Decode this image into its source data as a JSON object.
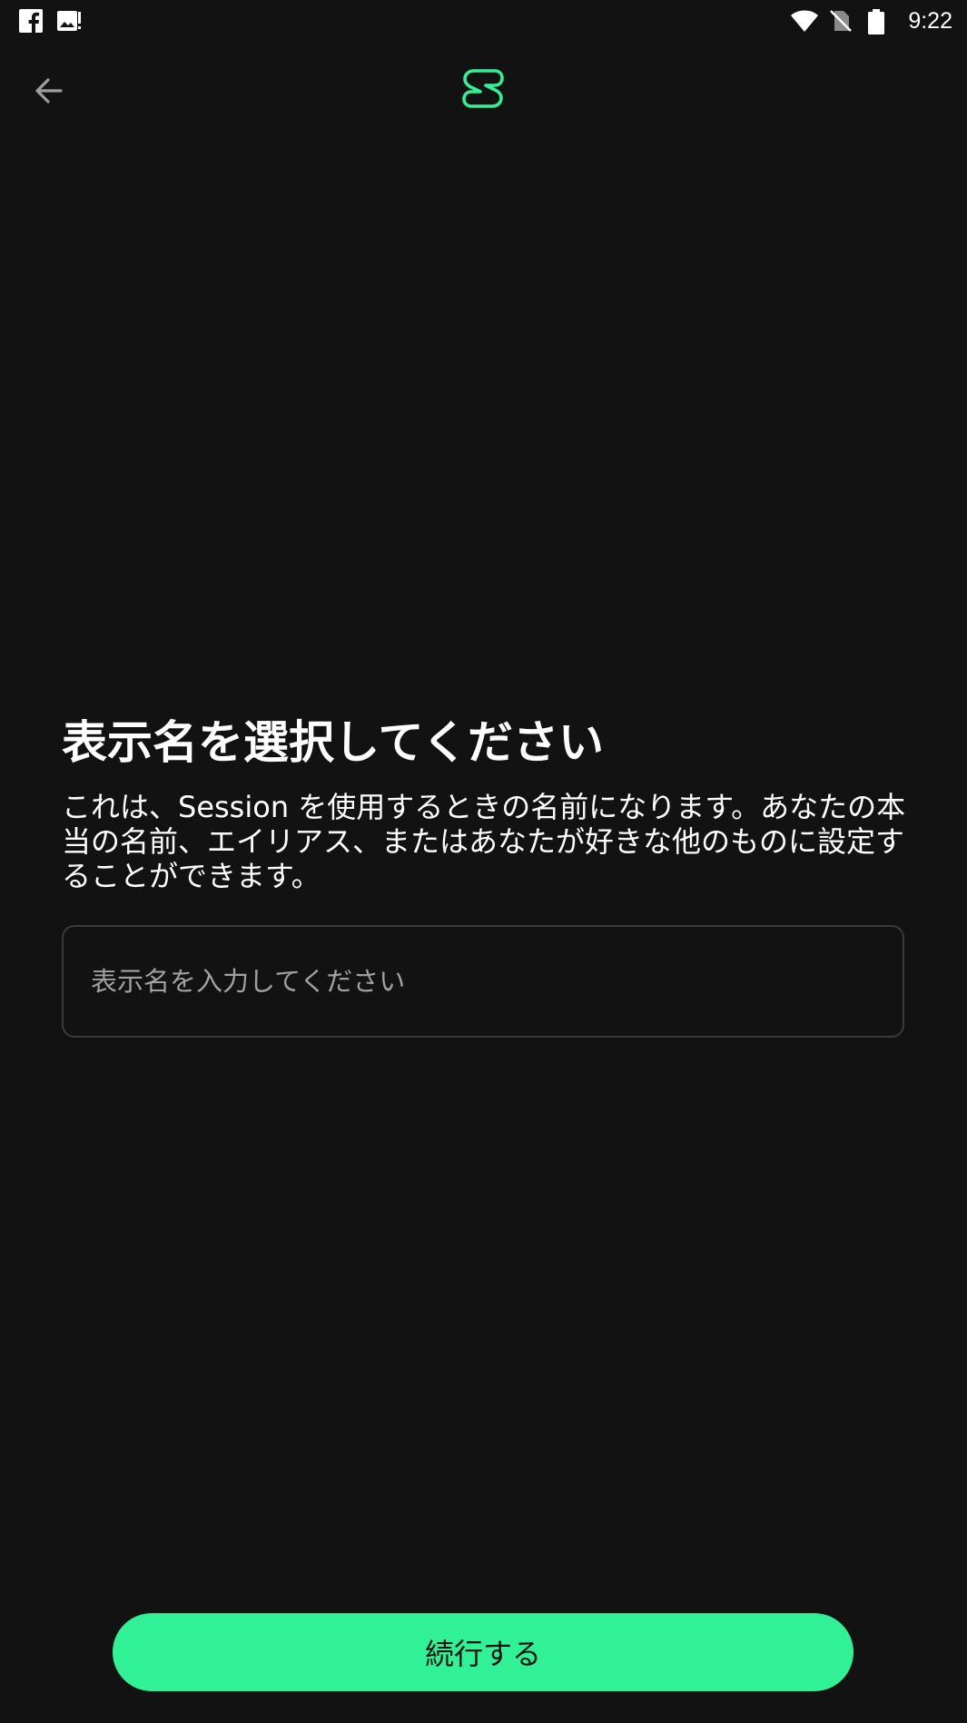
{
  "status_bar": {
    "time": "9:22",
    "left_icons": [
      "facebook-icon",
      "image-alert-icon"
    ],
    "right_icons": [
      "wifi-icon",
      "no-sim-icon",
      "battery-icon"
    ]
  },
  "header": {
    "back_icon": "arrow-left-icon",
    "logo_icon": "session-logo-icon",
    "accent_color": "#31f196"
  },
  "main": {
    "title": "表示名を選択してください",
    "description": "これは、Session を使用するときの名前になります。あなたの本当の名前、エイリアス、またはあなたが好きな他のものに設定することができます。",
    "name_input": {
      "value": "",
      "placeholder": "表示名を入力してください"
    }
  },
  "footer": {
    "continue_label": "続行する"
  }
}
